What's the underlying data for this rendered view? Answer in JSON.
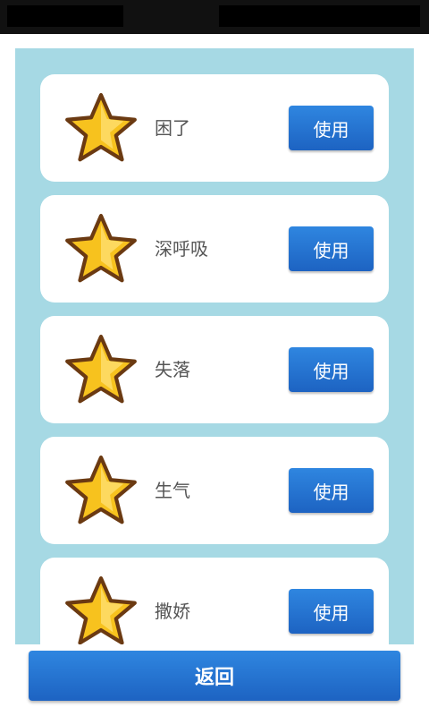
{
  "items": [
    {
      "label": "困了",
      "button_label": "使用",
      "icon": "star-icon"
    },
    {
      "label": "深呼吸",
      "button_label": "使用",
      "icon": "star-icon"
    },
    {
      "label": "失落",
      "button_label": "使用",
      "icon": "star-icon"
    },
    {
      "label": "生气",
      "button_label": "使用",
      "icon": "star-icon"
    },
    {
      "label": "撒娇",
      "button_label": "使用",
      "icon": "star-icon"
    }
  ],
  "back_label": "返回",
  "colors": {
    "panel_bg": "#a6d9e4",
    "button_blue": "#1f6fd1",
    "star_fill": "#f7c21e",
    "star_outline": "#6b3a12"
  }
}
